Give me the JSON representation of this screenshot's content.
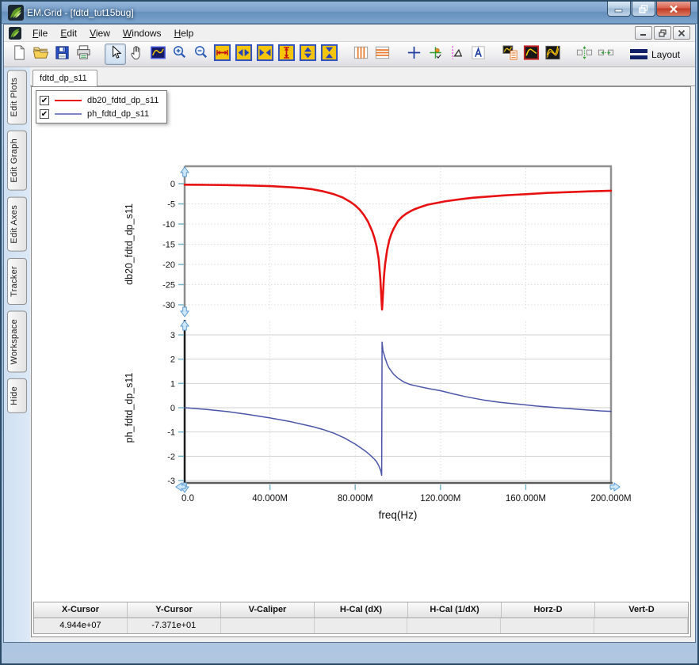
{
  "window": {
    "title": "EM.Grid - [fdtd_tut15bug]",
    "controls": [
      "minimize",
      "restore",
      "close"
    ]
  },
  "menu": {
    "items": [
      "File",
      "Edit",
      "View",
      "Windows",
      "Help"
    ]
  },
  "mdi_controls": [
    "minimize",
    "restore",
    "close"
  ],
  "toolbar": {
    "groups": [
      [
        "new",
        "open",
        "save",
        "print"
      ],
      [
        "select",
        "pan",
        "zoom-box",
        "zoom-in",
        "zoom-out",
        "expand-x",
        "stretch-x",
        "compress-x",
        "expand-y",
        "stretch-y",
        "compress-y"
      ],
      [
        "v-gridlines",
        "h-gridlines"
      ],
      [
        "crosshair",
        "tracker",
        "caliper",
        "text-label"
      ],
      [
        "legend",
        "single-trace",
        "multi-trace"
      ],
      [
        "fit-vertical",
        "fit-horizontal"
      ]
    ],
    "active_icon": "select",
    "layout_label": "Layout"
  },
  "sidebar": {
    "buttons": [
      "Edit Plots",
      "Edit Graph",
      "Edit Axes",
      "Tracker",
      "Workspace",
      "Hide"
    ]
  },
  "tabs": [
    {
      "label": "fdtd_dp_s11",
      "active": true
    }
  ],
  "legend": {
    "entries": [
      {
        "checked": true,
        "color": "#e81111",
        "weight": 2.5,
        "label": "db20_fdtd_dp_s11"
      },
      {
        "checked": true,
        "color": "#7b84c4",
        "weight": 2,
        "label": "ph_fdtd_dp_s11"
      }
    ]
  },
  "chart_data": [
    {
      "type": "line",
      "ylabel": "db20_fdtd_dp_s11",
      "x_unit": "MHz",
      "xlim": [
        0,
        200
      ],
      "ylim": [
        -33,
        4
      ],
      "yticks": [
        0,
        -5,
        -10,
        -15,
        -20,
        -25,
        -30
      ],
      "ytick_labels": [
        "0",
        "-5",
        "-10",
        "-15",
        "-20",
        "-25",
        "-30"
      ],
      "grid": "dotted",
      "series": [
        {
          "name": "db20_fdtd_dp_s11",
          "color": "#e81111",
          "x": [
            0,
            10,
            20,
            30,
            40,
            50,
            55,
            60,
            65,
            70,
            74,
            78,
            80,
            82,
            84,
            86,
            88,
            89,
            90,
            91,
            91.8,
            92.3,
            92.6,
            93,
            93.5,
            94,
            95,
            96,
            97,
            98,
            100,
            102,
            104,
            106,
            108,
            110,
            114,
            118,
            122,
            126,
            130,
            135,
            140,
            145,
            150,
            155,
            160,
            170,
            180,
            190,
            200
          ],
          "y": [
            -0.25,
            -0.3,
            -0.35,
            -0.45,
            -0.6,
            -0.9,
            -1.1,
            -1.4,
            -1.9,
            -2.6,
            -3.4,
            -4.6,
            -5.4,
            -6.4,
            -7.7,
            -9.4,
            -11.8,
            -13.4,
            -15.5,
            -18.6,
            -23.5,
            -28.5,
            -31.2,
            -27.5,
            -23,
            -20,
            -16.4,
            -14,
            -12.4,
            -11.2,
            -9.3,
            -8.2,
            -7.4,
            -6.8,
            -6.3,
            -5.9,
            -5.2,
            -4.8,
            -4.4,
            -4.1,
            -3.8,
            -3.5,
            -3.3,
            -3.1,
            -2.9,
            -2.75,
            -2.6,
            -2.3,
            -2.1,
            -1.9,
            -1.75
          ]
        }
      ]
    },
    {
      "type": "line",
      "ylabel": "ph_fdtd_dp_s11",
      "xlabel": "freq(Hz)",
      "x_unit": "MHz",
      "xlim": [
        0,
        200
      ],
      "ylim": [
        -3.2,
        3.2
      ],
      "yticks": [
        3,
        2,
        1,
        0,
        -1,
        -2,
        -3
      ],
      "ytick_labels": [
        "3",
        "2",
        "1",
        "0",
        "-1",
        "-2",
        "-3"
      ],
      "xticks": [
        0,
        40,
        80,
        120,
        160,
        200
      ],
      "xtick_labels": [
        "0.0",
        "40.000M",
        "80.000M",
        "120.000M",
        "160.000M",
        "200.000M"
      ],
      "grid": "solid",
      "series": [
        {
          "name": "ph_fdtd_dp_s11",
          "color": "#4a55a8",
          "x": [
            0,
            10,
            20,
            30,
            40,
            50,
            55,
            60,
            65,
            70,
            75,
            80,
            83,
            85,
            87,
            89,
            90,
            91,
            92,
            92.4,
            92.6,
            93,
            94,
            95,
            96,
            98,
            100,
            103,
            106,
            110,
            115,
            120,
            126,
            132,
            140,
            148,
            156,
            165,
            175,
            185,
            195,
            200
          ],
          "y": [
            0,
            -0.07,
            -0.16,
            -0.28,
            -0.42,
            -0.58,
            -0.68,
            -0.78,
            -0.9,
            -1.05,
            -1.25,
            -1.5,
            -1.68,
            -1.8,
            -1.95,
            -2.12,
            -2.22,
            -2.38,
            -2.6,
            -2.78,
            2.7,
            2.35,
            2.05,
            1.8,
            1.62,
            1.38,
            1.22,
            1.05,
            0.95,
            0.87,
            0.78,
            0.7,
            0.57,
            0.45,
            0.32,
            0.22,
            0.15,
            0.07,
            0.0,
            -0.07,
            -0.13,
            -0.15
          ]
        }
      ]
    }
  ],
  "cursor_table": {
    "headers": [
      "X-Cursor",
      "Y-Cursor",
      "V-Caliper",
      "H-Cal (dX)",
      "H-Cal (1/dX)",
      "Horz-D",
      "Vert-D"
    ],
    "values": [
      "4.944e+07",
      "-7.371e+01",
      "",
      "",
      "",
      "",
      ""
    ]
  }
}
